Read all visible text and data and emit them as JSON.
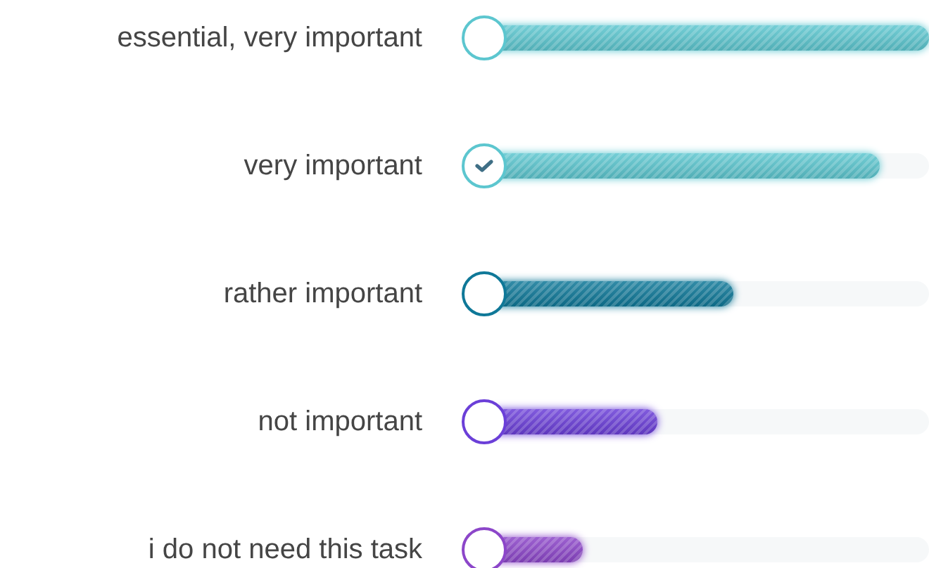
{
  "options": [
    {
      "label": "essential, very important",
      "selected": false,
      "level": 1.0,
      "color": "#5cc6cf"
    },
    {
      "label": "very important",
      "selected": true,
      "level": 0.89,
      "color": "#5cc6cf"
    },
    {
      "label": "rather important",
      "selected": false,
      "level": 0.56,
      "color": "#0f7898"
    },
    {
      "label": "not important",
      "selected": false,
      "level": 0.39,
      "color": "#6b3fd8"
    },
    {
      "label": "i do not need this task",
      "selected": false,
      "level": 0.22,
      "color": "#8c46c9"
    }
  ]
}
